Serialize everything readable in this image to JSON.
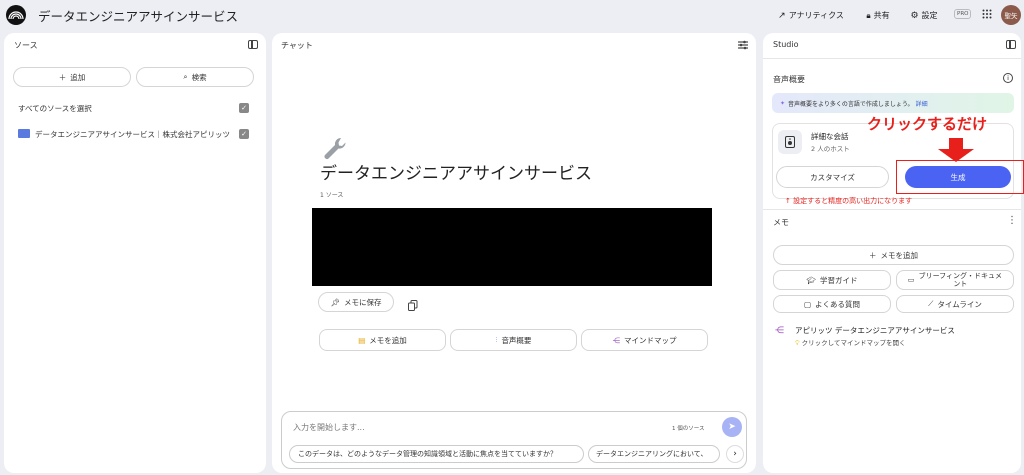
{
  "header": {
    "title": "データエンジニアアサインサービス",
    "analytics_label": "アナリティクス",
    "share_label": "共有",
    "settings_label": "設定",
    "pro_badge": "PRO",
    "avatar_text": "聖矢"
  },
  "sources": {
    "title": "ソース",
    "add_label": "追加",
    "search_label": "検索",
    "select_all_label": "すべてのソースを選択",
    "items": [
      {
        "label": "データエンジニアアサインサービス｜株式会社アピリッツ"
      }
    ]
  },
  "chat": {
    "title": "チャット",
    "notebook_title": "データエンジニアアサインサービス",
    "source_count": "1 ソース",
    "save_memo_label": "メモに保存",
    "actions": [
      "メモを追加",
      "音声概要",
      "マインドマップ"
    ],
    "input_placeholder": "入力を開始します...",
    "input_source_count": "1 個のソース",
    "suggestions": [
      "このデータは、どのようなデータ管理の知識領域と活動に焦点を当てていますか？",
      "データエンジニアリングにおいて、"
    ]
  },
  "studio": {
    "title": "Studio",
    "audio_title": "音声概要",
    "banner_text": "音声概要をより多くの言語で作成しましょう。",
    "banner_link": "詳細",
    "conversation_title": "詳細な会話",
    "conversation_sub": "2 人のホスト",
    "customize_label": "カスタマイズ",
    "generate_label": "生成",
    "annotation_click": "クリックするだけ",
    "annotation_note": "↑ 設定すると精度の高い出力になります",
    "memo_title": "メモ",
    "add_memo_label": "メモを追加",
    "memo_buttons": [
      "学習ガイド",
      "ブリーフィング・ドキュメント",
      "よくある質問",
      "タイムライン"
    ],
    "mindmap_title": "アピリッツ データエンジニアアサインサービス",
    "mindmap_sub": "クリックしてマインドマップを開く"
  },
  "colors": {
    "accent": "#4a63f2",
    "annotation": "#e8201b",
    "background": "#eceef4"
  }
}
